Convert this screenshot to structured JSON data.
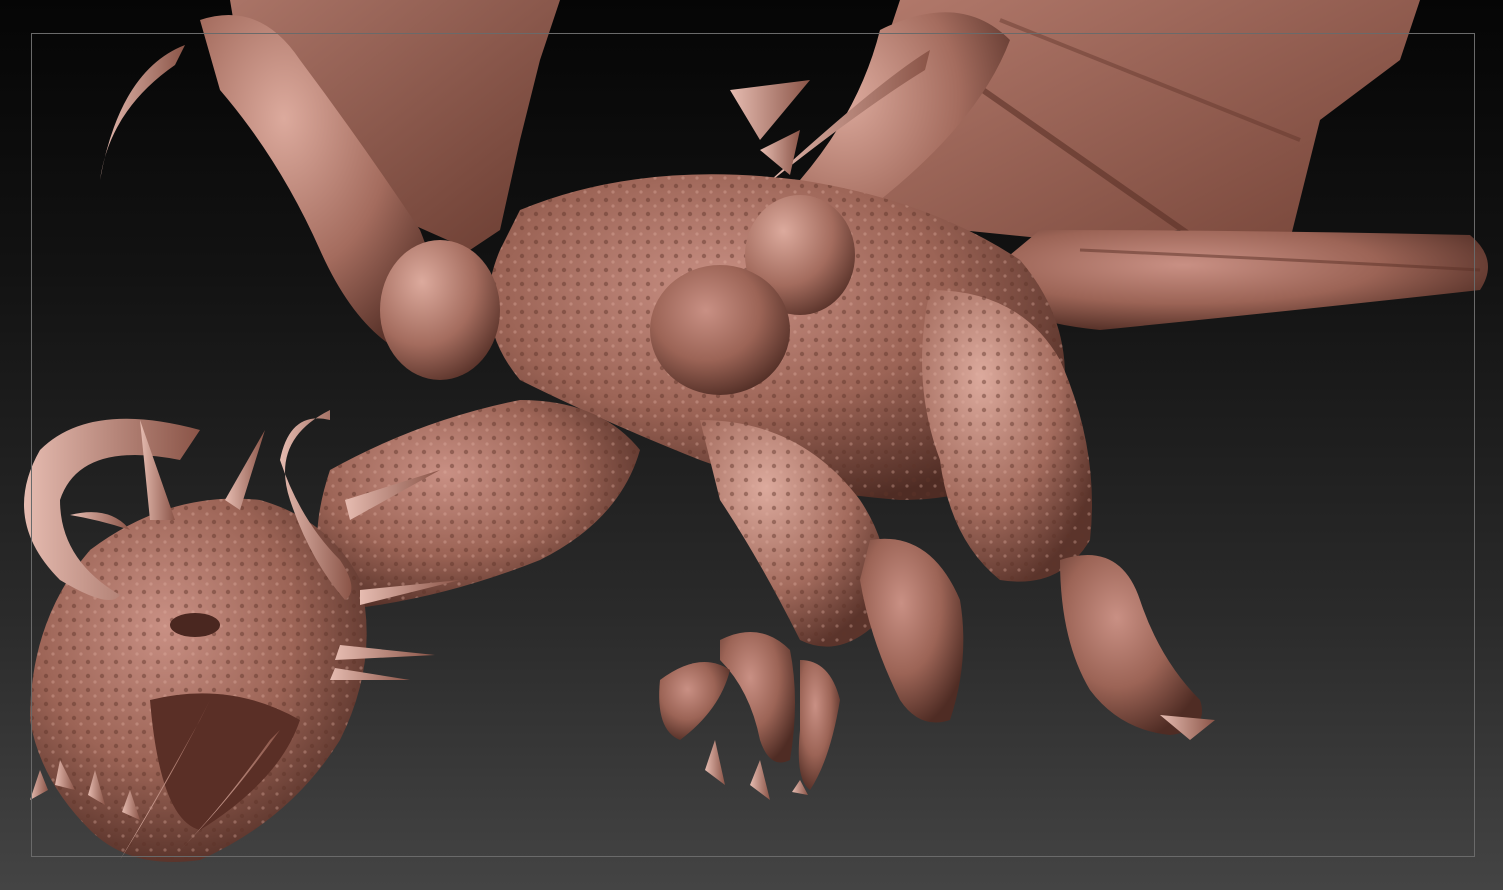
{
  "viewport": {
    "background_top": "#050505",
    "background_bottom": "#444444",
    "frame_color": "#6a6a6a",
    "model_material_color": "#a86f61",
    "model_highlight_color": "#d9a598",
    "model_shadow_color": "#4a2a22"
  },
  "model": {
    "subject": "dragon-sculpt"
  }
}
